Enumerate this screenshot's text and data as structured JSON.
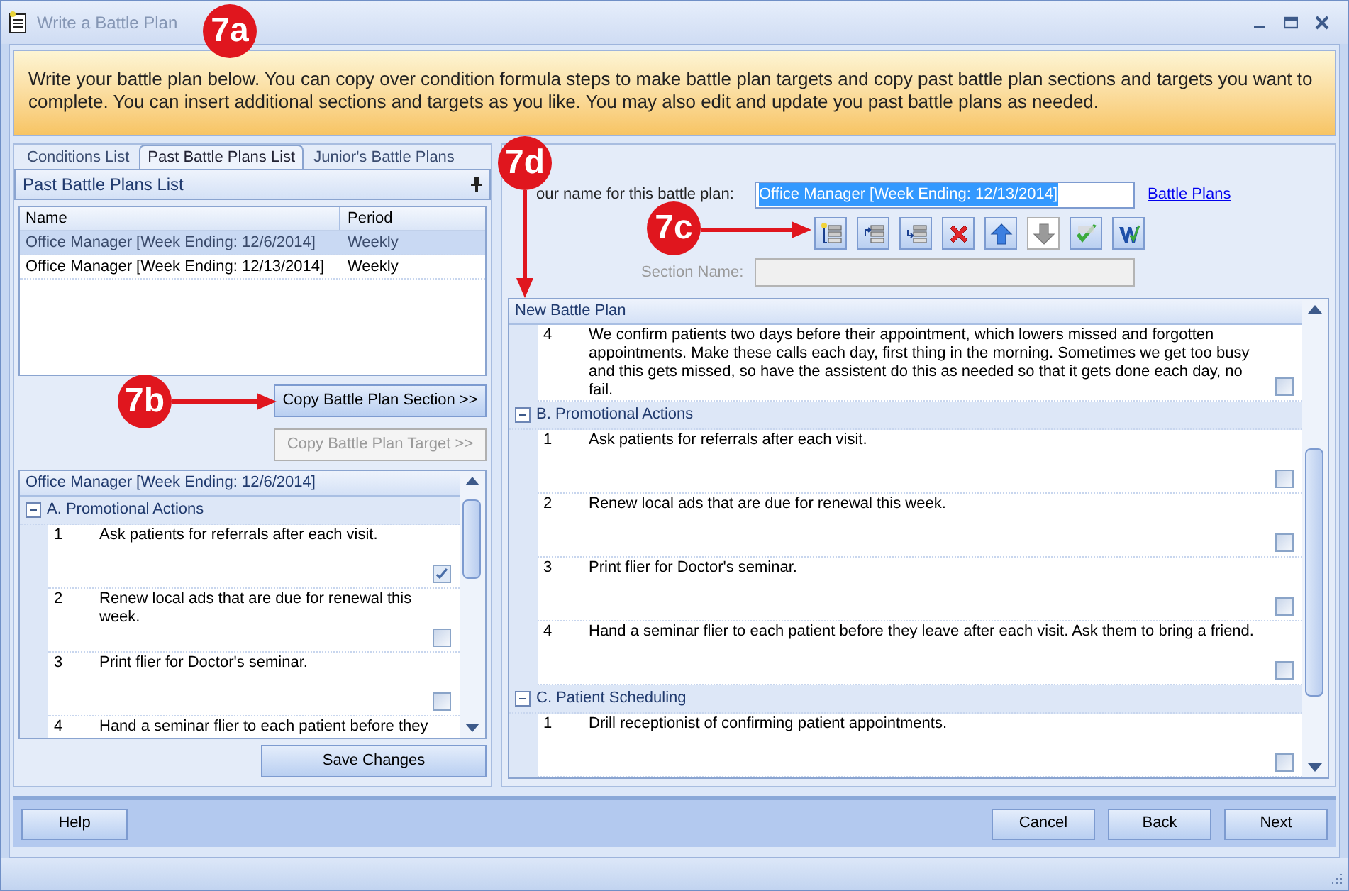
{
  "window": {
    "title": "Write a Battle Plan"
  },
  "banner": "Write your battle plan below. You can copy over condition formula steps to make battle plan targets and copy past battle plan sections and targets you want to complete. You can insert additional sections and targets as you like. You may also edit and update you past battle plans as needed.",
  "tabs": [
    {
      "label": "Conditions List",
      "selected": false
    },
    {
      "label": "Past Battle Plans List",
      "selected": true
    },
    {
      "label": "Junior's Battle Plans",
      "selected": false
    }
  ],
  "past_plans": {
    "title": "Past Battle Plans List",
    "columns": [
      "Name",
      "Period"
    ],
    "rows": [
      {
        "name": "Office Manager [Week Ending: 12/6/2014]",
        "period": "Weekly",
        "selected": true
      },
      {
        "name": "Office Manager [Week Ending: 12/13/2014]",
        "period": "Weekly",
        "selected": false
      }
    ]
  },
  "copy_buttons": [
    {
      "label": "Copy Battle Plan Section >>",
      "disabled": false
    },
    {
      "label": "Copy Battle Plan Target >>",
      "disabled": true
    }
  ],
  "preview": {
    "title": "Office Manager [Week Ending: 12/6/2014]",
    "sections": [
      {
        "label": "A. Promotional Actions",
        "expanded": true,
        "targets": [
          {
            "number": "1",
            "text": "Ask patients for referrals after each visit.",
            "checked": true
          },
          {
            "number": "2",
            "text": "Renew local ads that are due for renewal this week.",
            "checked": false
          },
          {
            "number": "3",
            "text": "Print flier for Doctor's seminar.",
            "checked": false
          },
          {
            "number": "4",
            "text": "Hand a seminar flier to each patient before they"
          }
        ]
      }
    ]
  },
  "save_button": "Save Changes",
  "plan_name": {
    "label": "our name for this battle plan:",
    "value": "Office Manager [Week Ending: 12/13/2014]"
  },
  "link": "Battle Plans",
  "toolbar": [
    {
      "kind": "add-section",
      "disabled": false
    },
    {
      "kind": "insert-above",
      "disabled": false
    },
    {
      "kind": "insert-below",
      "disabled": false
    },
    {
      "kind": "delete",
      "disabled": false
    },
    {
      "kind": "move-up",
      "disabled": false
    },
    {
      "kind": "move-down",
      "disabled": true
    },
    {
      "kind": "spell-check",
      "disabled": false
    },
    {
      "kind": "word",
      "disabled": false
    }
  ],
  "section_name": {
    "label": "Section Name:",
    "disabled": true
  },
  "plan": {
    "title": "New Battle Plan",
    "sections": [
      {
        "targets": [
          {
            "number": "4",
            "text": "We confirm patients two days before their appointment, which lowers missed and forgotten appointments. Make these calls each day, first thing in the morning. Sometimes we get too busy and this gets missed, so have the assistent do this as needed so that it gets done each day, no fail.",
            "checked": false
          }
        ]
      },
      {
        "label": "B. Promotional Actions",
        "expanded": true,
        "targets": [
          {
            "number": "1",
            "text": "Ask patients for referrals after each visit.",
            "checked": false
          },
          {
            "number": "2",
            "text": "Renew local ads that are due for renewal this week.",
            "checked": false
          },
          {
            "number": "3",
            "text": "Print flier for Doctor's seminar.",
            "checked": false
          },
          {
            "number": "4",
            "text": "Hand a seminar flier to each patient before they leave after each visit. Ask them to bring a friend.",
            "checked": false
          }
        ]
      },
      {
        "label": "C. Patient Scheduling",
        "expanded": true,
        "targets": [
          {
            "number": "1",
            "text": "Drill receptionist of confirming patient appointments.",
            "checked": false
          }
        ]
      }
    ]
  },
  "help_button": "Help",
  "nav_buttons": [
    "Cancel",
    "Back",
    "Next"
  ],
  "callouts": [
    "7a",
    "7b",
    "7c",
    "7d"
  ]
}
